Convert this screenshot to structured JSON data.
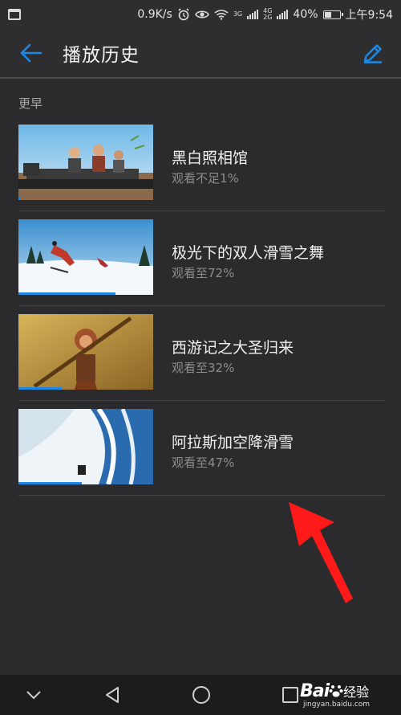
{
  "status_bar": {
    "speed": "0.9K/s",
    "net1": "3G",
    "net2_top": "4G",
    "net2_bottom": "2G",
    "battery": "40%",
    "time": "上午9:54"
  },
  "app_bar": {
    "title": "播放历史"
  },
  "section": {
    "label": "更早"
  },
  "history": [
    {
      "title": "黑白照相馆",
      "progress_text": "观看不足1%",
      "progress": 0.01
    },
    {
      "title": "极光下的双人滑雪之舞",
      "progress_text": "观看至72%",
      "progress": 0.72
    },
    {
      "title": "西游记之大圣归来",
      "progress_text": "观看至32%",
      "progress": 0.32
    },
    {
      "title": "阿拉斯加空降滑雪",
      "progress_text": "观看至47%",
      "progress": 0.47
    }
  ],
  "watermark": {
    "logo": "Bai",
    "logo_suffix": "经验",
    "url": "jingyan.baidu.com"
  },
  "colors": {
    "accent": "#1e88e5",
    "background": "#2b2b2d",
    "annotation_arrow": "#ff1a1a"
  },
  "icons": {
    "back": "arrow-left-icon",
    "edit": "pencil-icon",
    "nav_back": "triangle-back-icon",
    "nav_home": "circle-home-icon",
    "nav_recent": "square-recent-icon",
    "nav_collapse": "chevron-down-icon"
  }
}
